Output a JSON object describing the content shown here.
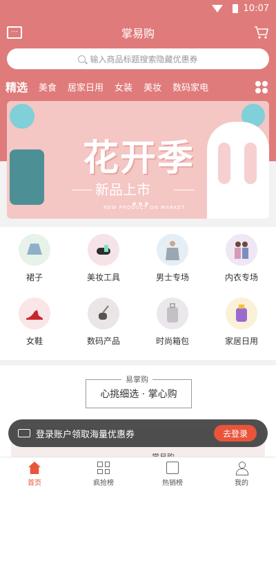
{
  "status": {
    "time": "10:07"
  },
  "header": {
    "title": "掌易购"
  },
  "search": {
    "placeholder": "输入商品标题搜索隐藏优惠券"
  },
  "nav": {
    "tabs": [
      "精选",
      "美食",
      "居家日用",
      "女装",
      "美妆",
      "数码家电"
    ]
  },
  "banner": {
    "title": "花开季",
    "subtitle": "新品上市",
    "english": "NEW PRODUCT ON MARKET"
  },
  "categories": [
    {
      "label": "裙子",
      "icon": "skirt-icon",
      "bg": "#e7f2e8"
    },
    {
      "label": "美妆工具",
      "icon": "makeup-tools-icon",
      "bg": "#f6e3e8"
    },
    {
      "label": "男士专场",
      "icon": "menswear-icon",
      "bg": "#e6eef5"
    },
    {
      "label": "内衣专场",
      "icon": "underwear-icon",
      "bg": "#efe7f3"
    },
    {
      "label": "女鞋",
      "icon": "womens-shoes-icon",
      "bg": "#fae6e6"
    },
    {
      "label": "数码产品",
      "icon": "vacuum-icon",
      "bg": "#ebe5e5"
    },
    {
      "label": "时尚箱包",
      "icon": "luggage-icon",
      "bg": "#eae8ea"
    },
    {
      "label": "家居日用",
      "icon": "household-icon",
      "bg": "#fbf0d8"
    }
  ],
  "section": {
    "tag": "易掌购",
    "slogan": "心挑细选 · 掌心购",
    "brand": "掌易购"
  },
  "toast": {
    "text": "登录账户领取海量优惠券",
    "button": "去登录"
  },
  "tabbar": [
    {
      "label": "首页",
      "active": true
    },
    {
      "label": "疯抢榜",
      "active": false
    },
    {
      "label": "热销榜",
      "active": false
    },
    {
      "label": "我的",
      "active": false
    }
  ],
  "colors": {
    "primary": "#e07b7b",
    "accent": "#e9543a"
  }
}
